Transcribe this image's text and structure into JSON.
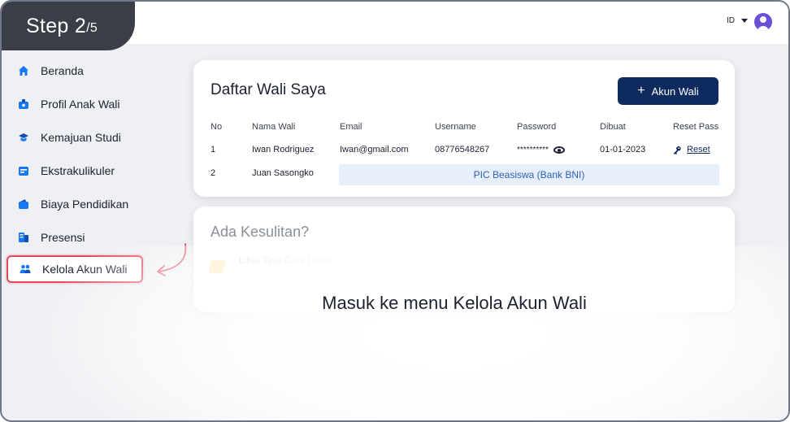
{
  "step": {
    "label": "Step 2",
    "total": "/5"
  },
  "header": {
    "language": "ID"
  },
  "sidebar": {
    "items": [
      {
        "label": "Beranda",
        "icon": "home-icon"
      },
      {
        "label": "Profil Anak Wali",
        "icon": "profile-icon"
      },
      {
        "label": "Kemajuan Studi",
        "icon": "graduation-cap-icon"
      },
      {
        "label": "Ekstrakulikuler",
        "icon": "activity-icon"
      },
      {
        "label": "Biaya Pendidikan",
        "icon": "wallet-icon"
      },
      {
        "label": "Presensi",
        "icon": "attendance-icon"
      },
      {
        "label": "Kelola Akun Wali",
        "icon": "users-icon",
        "active": true
      }
    ]
  },
  "main": {
    "title": "Daftar Wali Saya",
    "add_button": "Akun Wali",
    "table": {
      "headers": [
        "No",
        "Nama Wali",
        "Email",
        "Username",
        "Password",
        "Dibuat",
        "Reset Pass"
      ],
      "rows": [
        {
          "no": "1",
          "name": "Iwan Rodriguez",
          "email": "Iwan@gmail.com",
          "username": "08776548267",
          "password": "**********",
          "created": "01-01-2023",
          "reset": "Reset"
        },
        {
          "no": "2",
          "name": "Juan Sasongko",
          "pic": "PIC Beasiswa (Bank BNI)"
        }
      ]
    }
  },
  "help": {
    "title": "Ada Kesulitan?",
    "item": "Lihat Tata Cara Disini"
  },
  "caption": "Masuk ke menu Kelola Akun Wali",
  "colors": {
    "primary": "#0f2a5e",
    "highlight": "#e04a5b",
    "icon_blue": "#1877f2",
    "avatar": "#6b4fd8"
  }
}
